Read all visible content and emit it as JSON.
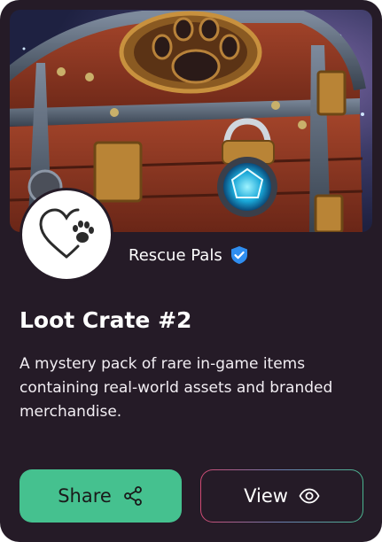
{
  "card": {
    "creator_name": "Rescue Pals",
    "title": "Loot Crate #2",
    "description": "A mystery pack of rare in-game items containing real-world assets and branded merchandise."
  },
  "actions": {
    "share_label": "Share",
    "view_label": "View"
  },
  "icons": {
    "hero": "treasure-chest-image",
    "avatar": "heart-paw-logo",
    "verified": "verified-badge-icon",
    "share": "share-icon",
    "view": "eye-icon"
  },
  "colors": {
    "card_bg": "#251b27",
    "share_bg": "#45c18f",
    "verified": "#2f8ef0"
  }
}
